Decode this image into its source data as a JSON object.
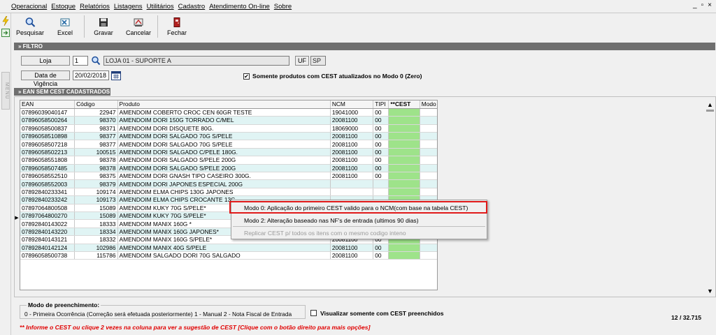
{
  "menu": [
    "Operacional",
    "Estoque",
    "Relatórios",
    "Listagens",
    "Utilitários",
    "Cadastro",
    "Atendimento On-line",
    "Sobre"
  ],
  "window_controls": {
    "min": "_",
    "restore": "▫",
    "close": "×"
  },
  "sidebar": {
    "tab_label": "MENU"
  },
  "toolbar": {
    "pesquisar": "Pesquisar",
    "excel": "Excel",
    "gravar": "Gravar",
    "cancelar": "Cancelar",
    "fechar": "Fechar"
  },
  "filtro": {
    "header": "» FILTRO",
    "loja_label": "Loja",
    "loja_code": "1",
    "loja_name": "LOJA 01 - SUPORTE A",
    "uf_label": "UF",
    "uf_value": "SP",
    "data_label": "Data de Vigência",
    "data_value": "20/02/2018",
    "somente_label": "Somente produtos com CEST atualizados no Modo 0 (Zero)",
    "somente_checked": "✔"
  },
  "grid": {
    "header": "» EAN SEM CEST CADASTRADOS",
    "columns": [
      "EAN",
      "Código",
      "Produto",
      "NCM",
      "TIPI",
      "**CEST",
      "Modo"
    ],
    "rows": [
      [
        "07896039040147",
        "22947",
        "AMENDOIM  COBERTO CROC CEN 60GR TESTE",
        "19041000",
        "00"
      ],
      [
        "07896058500264",
        "98370",
        "AMENDOIM DORI  150G TORRADO C/MEL",
        "20081100",
        "00"
      ],
      [
        "07896058500837",
        "98371",
        "AMENDOIM DORI  DISQUETE 80G.",
        "18069000",
        "00"
      ],
      [
        "07896058510898",
        "98377",
        "AMENDOIM DORI  SALGADO  70G S/PELE",
        "20081100",
        "00"
      ],
      [
        "07896058507218",
        "98377",
        "AMENDOIM DORI  SALGADO  70G S/PELE",
        "20081100",
        "00"
      ],
      [
        "07896058502213",
        "100515",
        "AMENDOIM DORI  SALGADO C/PELE 180G.",
        "20081100",
        "00"
      ],
      [
        "07896058551808",
        "98378",
        "AMENDOIM DORI  SALGADO S/PELE 200G",
        "20081100",
        "00"
      ],
      [
        "07896058507485",
        "98378",
        "AMENDOIM DORI  SALGADO S/PELE 200G",
        "20081100",
        "00"
      ],
      [
        "07896058552510",
        "98375",
        "AMENDOIM DORI GNASH TIPO CASEIRO 300G.",
        "20081100",
        "00"
      ],
      [
        "07896058552003",
        "98379",
        "AMENDOIM DORI JAPONES ESPECIAL 200G",
        "",
        ""
      ],
      [
        "07892840233341",
        "109174",
        "AMENDOIM ELMA CHIPS  130G JAPONES",
        "",
        ""
      ],
      [
        "07892840233242",
        "109173",
        "AMENDOIM ELMA CHIPS CROCANTE  13C",
        "",
        ""
      ],
      [
        "07897064800508",
        "15089",
        "AMENDOIM KUKY 70G S/PELE*",
        "",
        ""
      ],
      [
        "07897064800270",
        "15089",
        "AMENDOIM KUKY 70G S/PELE*",
        "",
        ""
      ],
      [
        "07892840143022",
        "18333",
        "AMENDOIM MANIX 160G *",
        "20081100",
        "00"
      ],
      [
        "07892840143220",
        "18334",
        "AMENDOIM MANIX 160G JAPONES*",
        "20081100",
        "00"
      ],
      [
        "07892840143121",
        "18332",
        "AMENDOIM MANIX 160G S/PELE*",
        "20081100",
        "00"
      ],
      [
        "07892840142124",
        "102986",
        "AMENDOIM MANIX 40G S/PELE",
        "20081100",
        "00"
      ],
      [
        "07896058500738",
        "115786",
        "AMENDOIM SALGADO DORI 70G SALGADO",
        "20081100",
        "00"
      ]
    ],
    "current_row_marker": "▶",
    "scroll_up": "▲",
    "scroll_down": "▼"
  },
  "context_menu": {
    "item1": "Modo 0:  Aplicação do primeiro CEST  valido para o NCM(com base na tabela CEST)",
    "item2": "Modo 2:  Alteração baseado nas NF's de entrada (ultimos 90 dias)",
    "item3": "Replicar CEST p/  todos os itens com o mesmo codigo inteno"
  },
  "footer": {
    "modo_title": "Modo de preenchimento:",
    "modo_text": "0 - Primeira Ocorrência (Correção será efetuada posteriormente)     1 - Manual     2 - Nota Fiscal de Entrada",
    "visualizar_label": "Visualizar somente com CEST preenchidos",
    "counter": "12 / 32.715",
    "hint": "** Informe o CEST ou clique 2 vezes na coluna para ver a sugestão de CEST    [Clique com o botão direito para mais opções]"
  },
  "colors": {
    "panel_head": "#6f6f6f",
    "cest": "#9ee38a",
    "alt_row": "#e0f4f4",
    "highlight": "#e01a1a",
    "hint": "#e00000"
  }
}
